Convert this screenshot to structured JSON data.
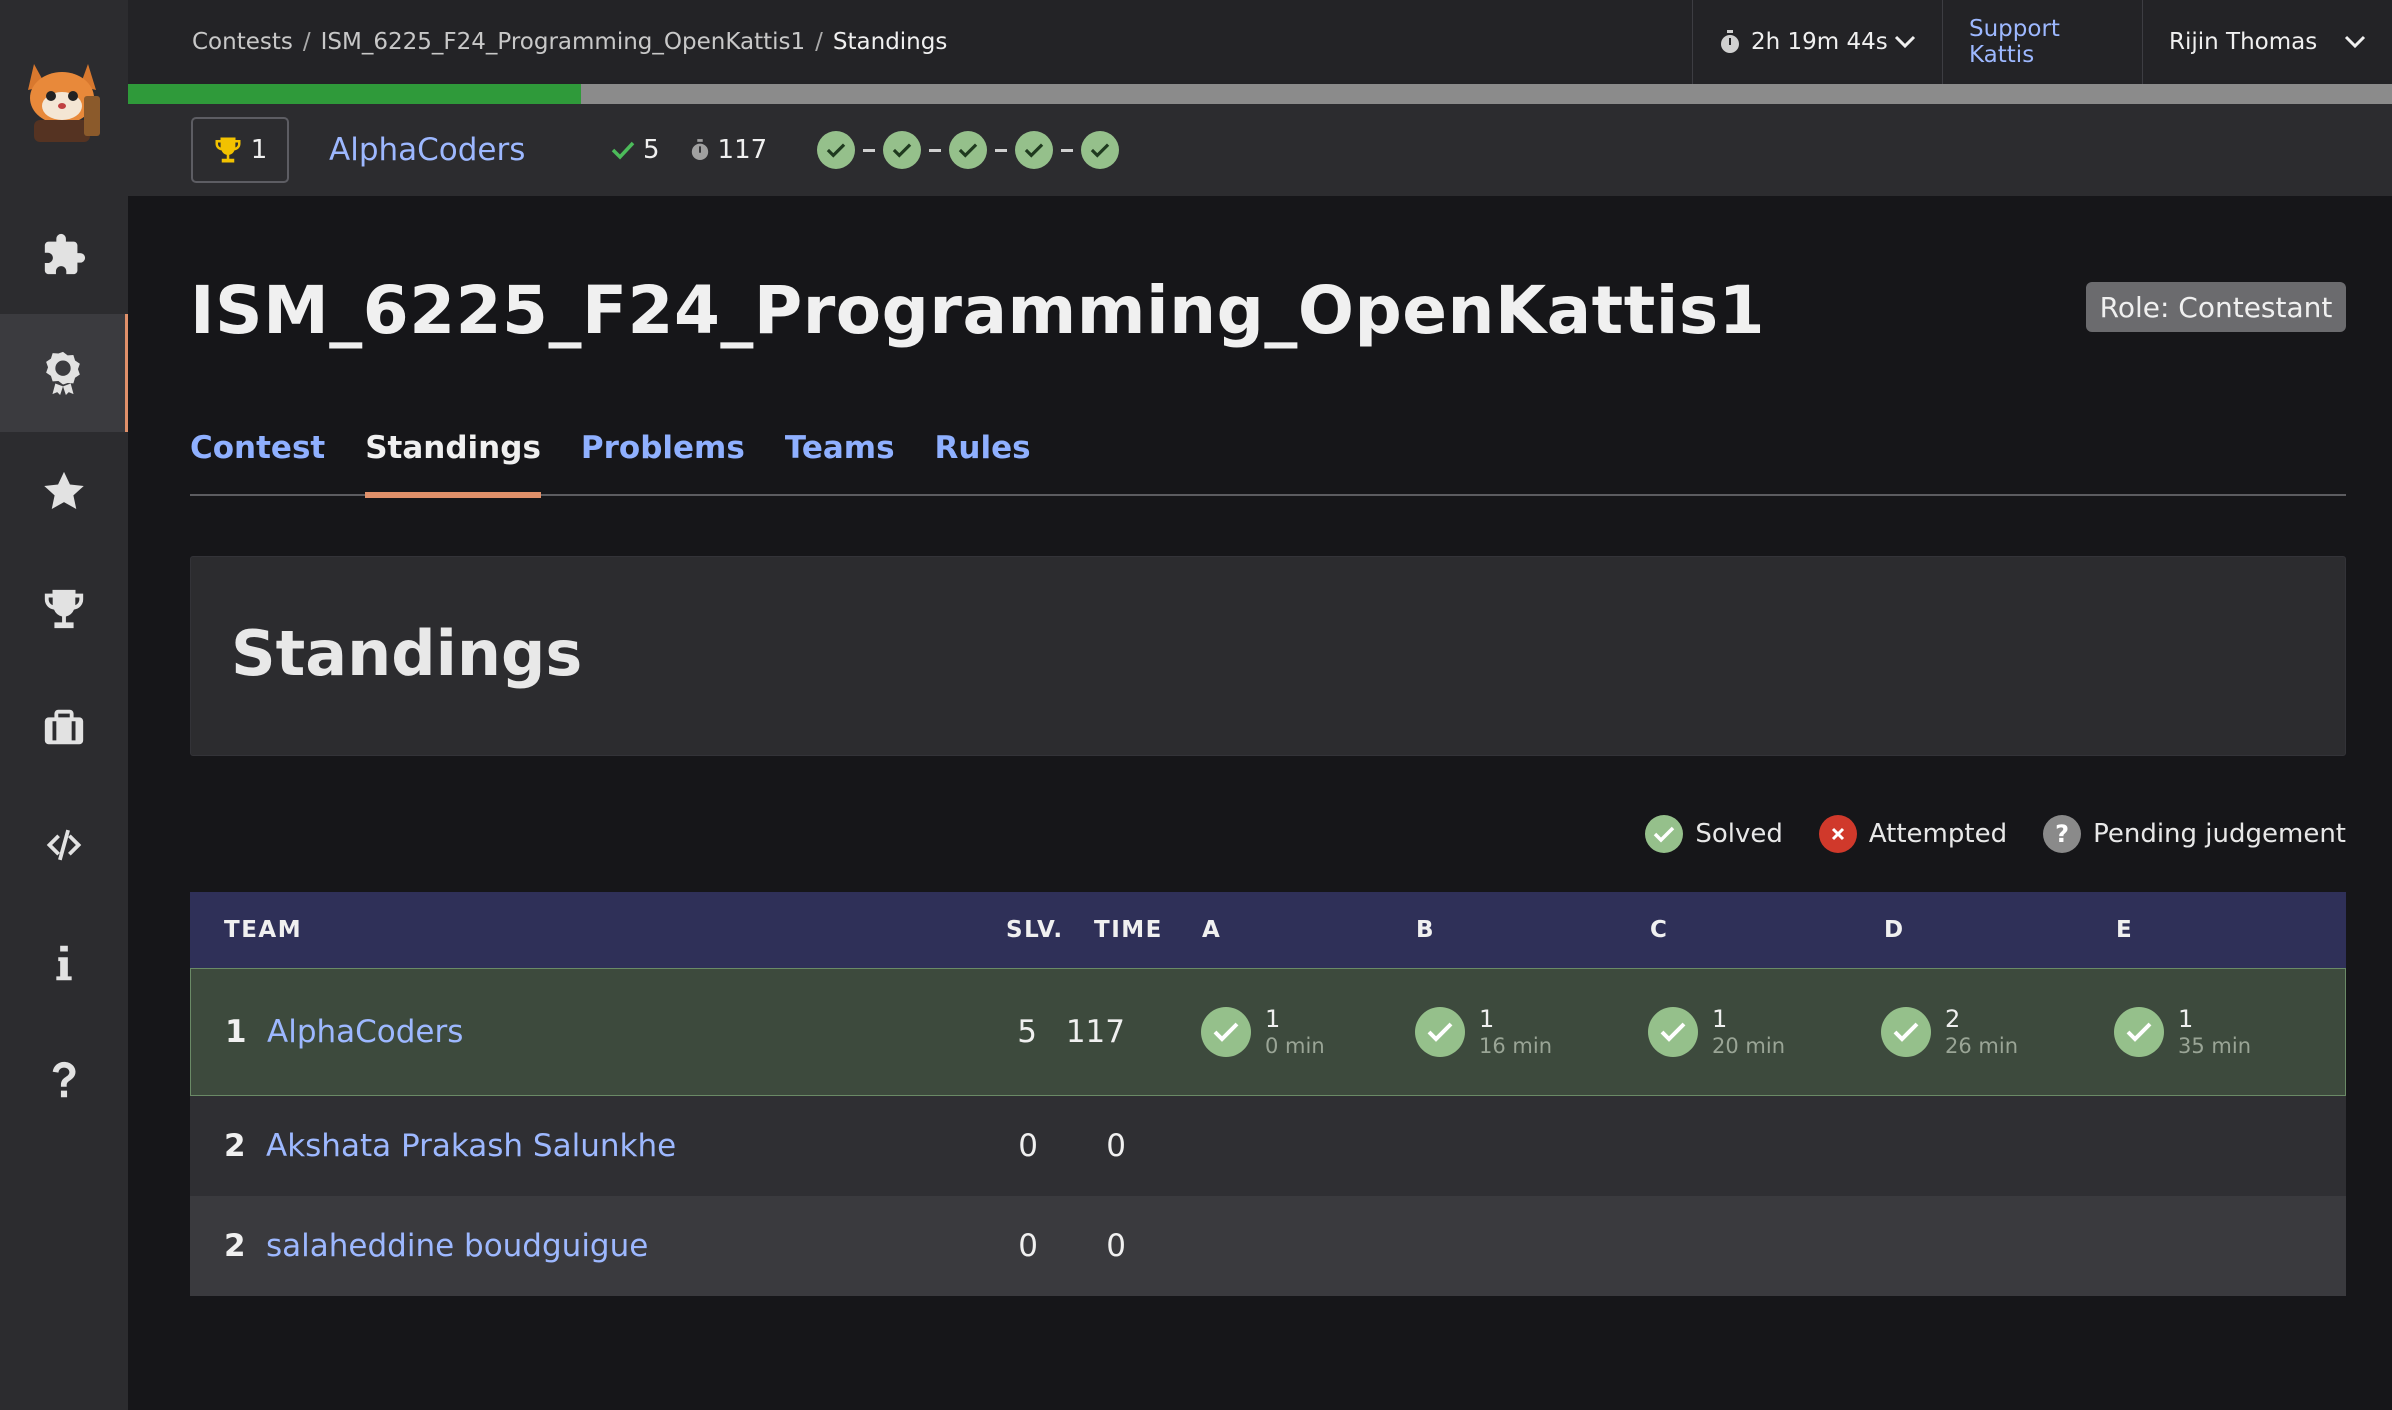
{
  "breadcrumb": {
    "items": [
      "Contests",
      "ISM_6225_F24_Programming_OpenKattis1"
    ],
    "separator": "/",
    "current": "Standings"
  },
  "topbar": {
    "timer": "2h 19m 44s",
    "support": "Support Kattis",
    "user": "Rijin Thomas"
  },
  "progress": {
    "fraction": 0.2
  },
  "teambar": {
    "rank": "1",
    "team": "AlphaCoders",
    "solved": "5",
    "penalty": "117",
    "problems_solved": 5
  },
  "page": {
    "title": "ISM_6225_F24_Programming_OpenKattis1",
    "role": "Role: Contestant"
  },
  "tabs": [
    {
      "label": "Contest",
      "active": false
    },
    {
      "label": "Standings",
      "active": true
    },
    {
      "label": "Problems",
      "active": false
    },
    {
      "label": "Teams",
      "active": false
    },
    {
      "label": "Rules",
      "active": false
    }
  ],
  "section": {
    "heading": "Standings"
  },
  "legend": {
    "solved": "Solved",
    "attempted": "Attempted",
    "pending": "Pending judgement",
    "colors": {
      "solved": "#95c08b",
      "attempted": "#d0392b",
      "pending": "#8a8a8a"
    }
  },
  "table": {
    "headers": {
      "team": "TEAM",
      "slv": "SLV.",
      "time": "TIME",
      "problems": [
        "A",
        "B",
        "C",
        "D",
        "E"
      ]
    },
    "rows": [
      {
        "rank": "1",
        "team": "AlphaCoders",
        "slv": "5",
        "time": "117",
        "problems": [
          {
            "tries": "1",
            "time": "0 min"
          },
          {
            "tries": "1",
            "time": "16 min"
          },
          {
            "tries": "1",
            "time": "20 min"
          },
          {
            "tries": "2",
            "time": "26 min"
          },
          {
            "tries": "1",
            "time": "35 min"
          }
        ]
      },
      {
        "rank": "2",
        "team": "Akshata Prakash Salunkhe",
        "slv": "0",
        "time": "0"
      },
      {
        "rank": "2",
        "team": "salaheddine boudguigue",
        "slv": "0",
        "time": "0"
      }
    ]
  },
  "colors": {
    "accent": "#e0906a",
    "link": "#9db8ff",
    "solved": "#95c08b",
    "header": "#2f3058"
  },
  "sidebar": {
    "icons": [
      "puzzle-icon",
      "badge-icon",
      "star-icon",
      "trophy-icon",
      "briefcase-icon",
      "code-icon",
      "info-icon",
      "help-icon"
    ],
    "active_index": 1
  }
}
